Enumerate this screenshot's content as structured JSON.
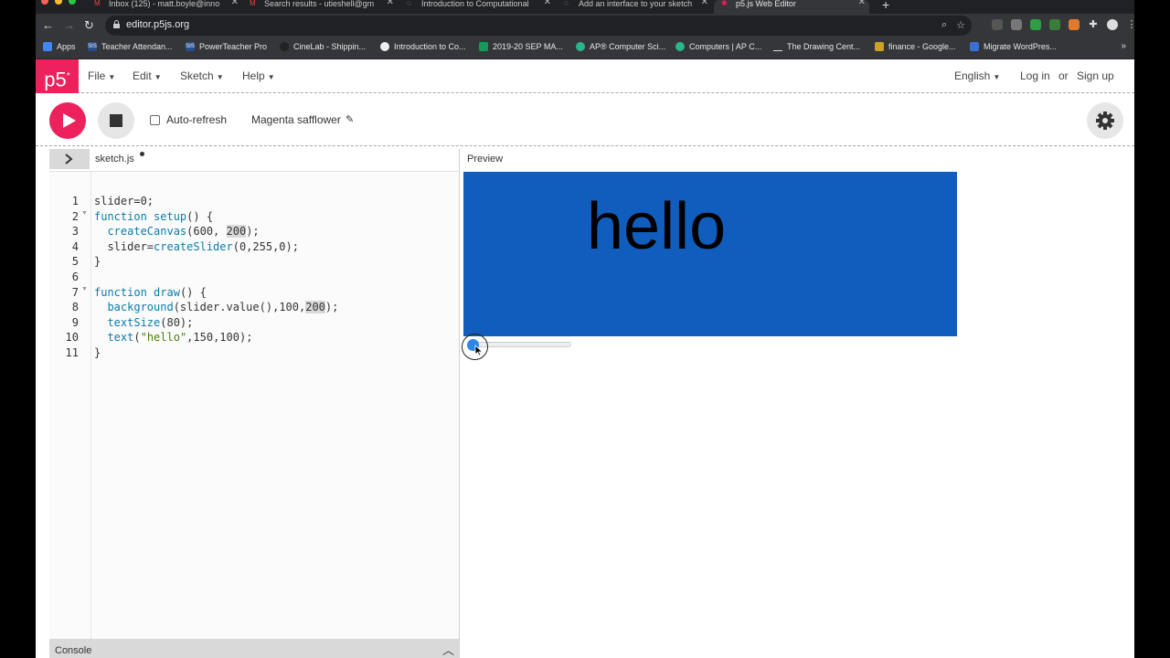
{
  "browser": {
    "tabs": [
      {
        "label": "Inbox (125) - matt.boyle@inno",
        "icon": "gmail-icon"
      },
      {
        "label": "Search results - utieshell@gm",
        "icon": "gmail-icon"
      },
      {
        "label": "Introduction to Computational",
        "icon": "globe-icon"
      },
      {
        "label": "Add an interface to your sketch",
        "icon": "globe-icon"
      },
      {
        "label": "p5.js Web Editor",
        "icon": "p5-icon"
      }
    ],
    "url": "editor.p5js.org",
    "bookmarks": [
      "Apps",
      "Teacher Attendan...",
      "PowerTeacher Pro",
      "CineLab - Shippin...",
      "Introduction to Co...",
      "2019-20 SEP MA...",
      "AP® Computer Sci...",
      "Computers | AP C...",
      "The Drawing Cent...",
      "finance - Google...",
      "Migrate WordPres..."
    ],
    "bookmarks_more": "»"
  },
  "nav": {
    "logo": "p5",
    "menus": [
      "File",
      "Edit",
      "Sketch",
      "Help"
    ],
    "language": "English",
    "login": "Log in",
    "or": "or",
    "signup": "Sign up"
  },
  "toolbar": {
    "auto_refresh": "Auto-refresh",
    "auto_refresh_checked": false,
    "project_name": "Magenta safflower"
  },
  "editor": {
    "filename": "sketch.js",
    "line_numbers": [
      "1",
      "2",
      "3",
      "4",
      "5",
      "6",
      "7",
      "8",
      "9",
      "10",
      "11"
    ],
    "lines": [
      "slider=0;",
      "function setup() {",
      "  createCanvas(600, 200);",
      "  slider=createSlider(0,255,0);",
      "}",
      "",
      "function draw() {",
      "  background(slider.value(),100,200);",
      "  textSize(80);",
      "  text(\"hello\",150,100);",
      "}"
    ]
  },
  "preview": {
    "label": "Preview",
    "canvas_text": "hello",
    "canvas_bg": "#115dbd",
    "slider_value": 0,
    "slider_min": 0,
    "slider_max": 255
  },
  "console": {
    "label": "Console"
  },
  "colors": {
    "accent": "#ed225d"
  }
}
